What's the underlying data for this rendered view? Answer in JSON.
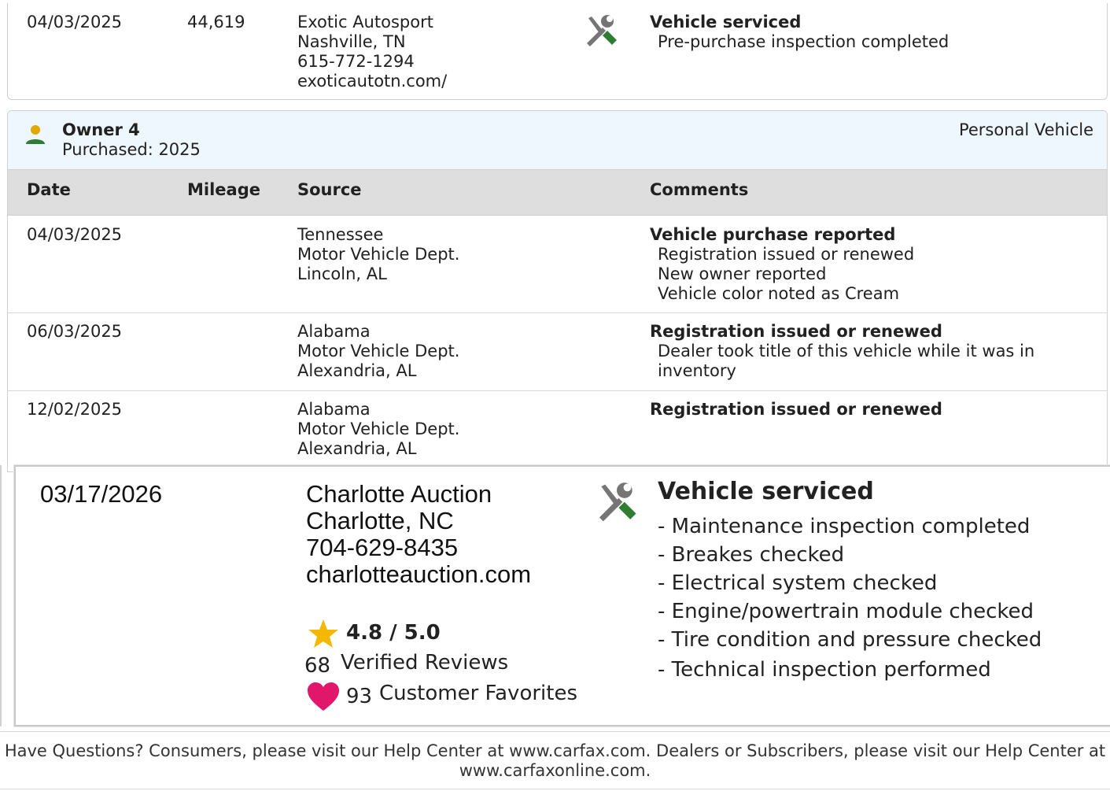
{
  "top_entry": {
    "date": "04/03/2025",
    "mileage": "44,619",
    "source": [
      "Exotic Autosport",
      "Nashville, TN",
      "615-772-1294",
      "exoticautotn.com/"
    ],
    "icon": "service-wrench-icon",
    "comment_title": "Vehicle serviced",
    "comment_lines": [
      "Pre-purchase inspection completed"
    ]
  },
  "owner": {
    "title": "Owner 4",
    "purchased": "Purchased: 2025",
    "usage": "Personal Vehicle",
    "icon": "owner-person-icon",
    "icon_color": "#2e7d32",
    "head_color": "#e0a800"
  },
  "table": {
    "headers": [
      "Date",
      "Mileage",
      "Source",
      "Comments"
    ],
    "rows": [
      {
        "date": "04/03/2025",
        "mileage": "",
        "source": [
          "Tennessee",
          "Motor Vehicle Dept.",
          "Lincoln, AL"
        ],
        "comment_title": "Vehicle purchase reported",
        "comment_lines": [
          "Registration issued or renewed",
          "New owner reported",
          "Vehicle color noted as Cream"
        ]
      },
      {
        "date": "06/03/2025",
        "mileage": "",
        "source": [
          "Alabama",
          "Motor Vehicle Dept.",
          "Alexandria, AL"
        ],
        "comment_title": "Registration issued or renewed",
        "comment_lines": [
          "Dealer took title of this vehicle while it was in",
          "inventory"
        ]
      },
      {
        "date": "12/02/2025",
        "mileage": "",
        "source": [
          "Alabama",
          "Motor Vehicle Dept.",
          "Alexandria, AL"
        ],
        "comment_title": "Registration issued or renewed",
        "comment_lines": []
      }
    ]
  },
  "highlight_entry": {
    "date": "03/17/2026",
    "source": [
      "Charlotte Auction",
      "Charlotte, NC",
      "704-629-8435",
      "charlotteauction.com"
    ],
    "rating": "4.8 / 5.0",
    "reviews_count": "68",
    "reviews_label": "Verified Reviews",
    "favorites_count": "93",
    "favorites_label": "Customer Favorites",
    "icon": "service-wrench-icon",
    "comment_title": "Vehicle serviced",
    "comment_lines": [
      "- Maintenance inspection completed",
      "- Breakes checked",
      "- Electrical system checked",
      "- Engine/powertrain module checked",
      "- Tire condition and pressure checked",
      "- Technical inspection performed"
    ],
    "star_color": "#f5b800",
    "heart_color": "#e0176b"
  },
  "footer": {
    "line1": "Have Questions? Consumers, please visit our Help Center at www.carfax.com. Dealers or Subscribers, please visit our Help Center at",
    "line2": "www.carfaxonline.com."
  },
  "colors": {
    "header_bg": "#dedede",
    "owner_bg": "#eef7fd",
    "wrench_green": "#2e7d32",
    "tool_gray": "#757575"
  }
}
